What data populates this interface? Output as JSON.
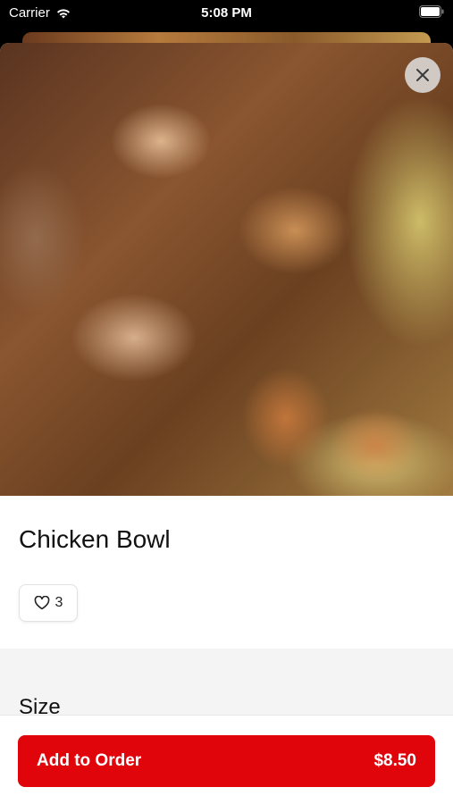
{
  "status_bar": {
    "carrier": "Carrier",
    "time": "5:08 PM"
  },
  "product": {
    "title": "Chicken Bowl",
    "likes": "3",
    "image_icon": "chicken-noodle-bowl-photo"
  },
  "icons": {
    "close": "close-icon",
    "heart": "heart-icon",
    "wifi": "wifi-icon",
    "battery": "battery-icon"
  },
  "options": {
    "section_title": "Size"
  },
  "cart": {
    "button_label": "Add to Order",
    "price": "$8.50"
  },
  "colors": {
    "accent": "#e0040b",
    "section_bg": "#f4f4f4"
  }
}
